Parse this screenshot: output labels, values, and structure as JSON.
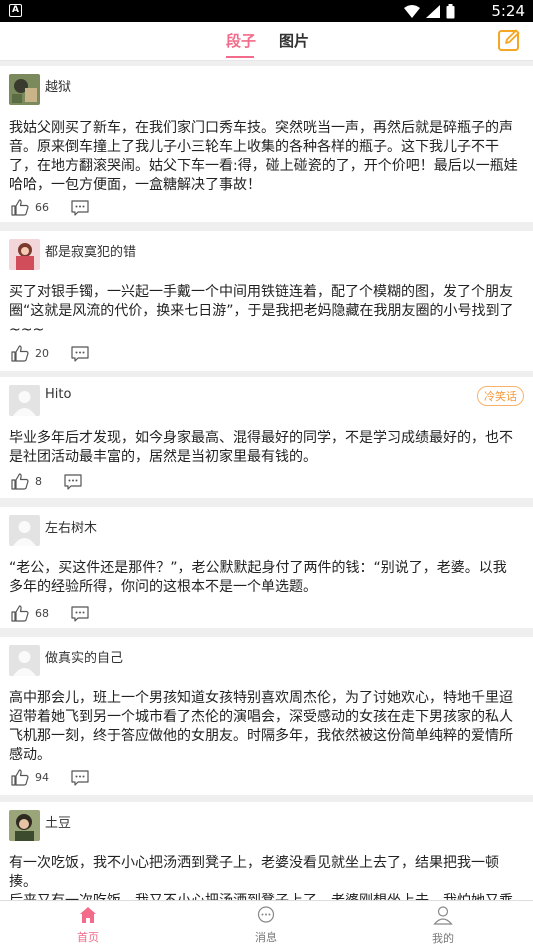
{
  "status_bar": {
    "time": "5:24",
    "notification_glyph": "A"
  },
  "header": {
    "tabs": [
      {
        "label": "段子",
        "active": true
      },
      {
        "label": "图片",
        "active": false
      }
    ],
    "accent_color": "#f26b8a",
    "edit_icon": "edit-icon"
  },
  "posts": [
    {
      "username": "越狱",
      "text": "我姑父刚买了新车，在我们家门口秀车技。突然咣当一声，再然后就是碎瓶子的声音。原来倒车撞上了我儿子小三轮车上收集的各种各样的瓶子。这下我儿子不干了，在地方翻滚哭闹。姑父下车一看:得，碰上碰瓷的了，开个价吧！最后以一瓶娃哈哈，一包方便面，一盒糖解决了事故！",
      "likes": "66"
    },
    {
      "username": "都是寂寞犯的错",
      "text": "买了对银手镯，一兴起一手戴一个中间用铁链连着，配了个模糊的图，发了个朋友圈“这就是风流的代价，换来七日游”，于是我把老妈隐藏在我朋友圈的小号找到了~~~",
      "likes": "20"
    },
    {
      "username": "Hito",
      "tag": "冷笑话",
      "text": "毕业多年后才发现，如今身家最高、混得最好的同学，不是学习成绩最好的，也不是社团活动最丰富的，居然是当初家里最有钱的。",
      "likes": "8"
    },
    {
      "username": "左右树木",
      "text": "“老公，买这件还是那件？”，老公默默起身付了两件的钱：“别说了，老婆。以我多年的经验所得，你问的这根本不是一个单选题。",
      "likes": "68"
    },
    {
      "username": "做真实的自己",
      "text": "高中那会儿，班上一个男孩知道女孩特别喜欢周杰伦，为了讨她欢心，特地千里迢迢带着她飞到另一个城市看了杰伦的演唱会，深受感动的女孩在走下男孩家的私人飞机那一刻，终于答应做他的女朋友。时隔多年，我依然被这份简单纯粹的爱情所感动。",
      "likes": "94"
    },
    {
      "username": "土豆",
      "text": "有一次吃饭，我不小心把汤洒到凳子上，老婆没看见就坐上去了，结果把我一顿揍。\n后来又有一次吃饭，我又不小心把汤洒到凳子上了，老婆刚想坐上去，我怕她又乘",
      "likes": ""
    }
  ],
  "bottom_nav": [
    {
      "label": "首页",
      "icon": "home-icon",
      "active": true
    },
    {
      "label": "消息",
      "icon": "message-icon",
      "active": false
    },
    {
      "label": "我的",
      "icon": "profile-icon",
      "active": false
    }
  ]
}
